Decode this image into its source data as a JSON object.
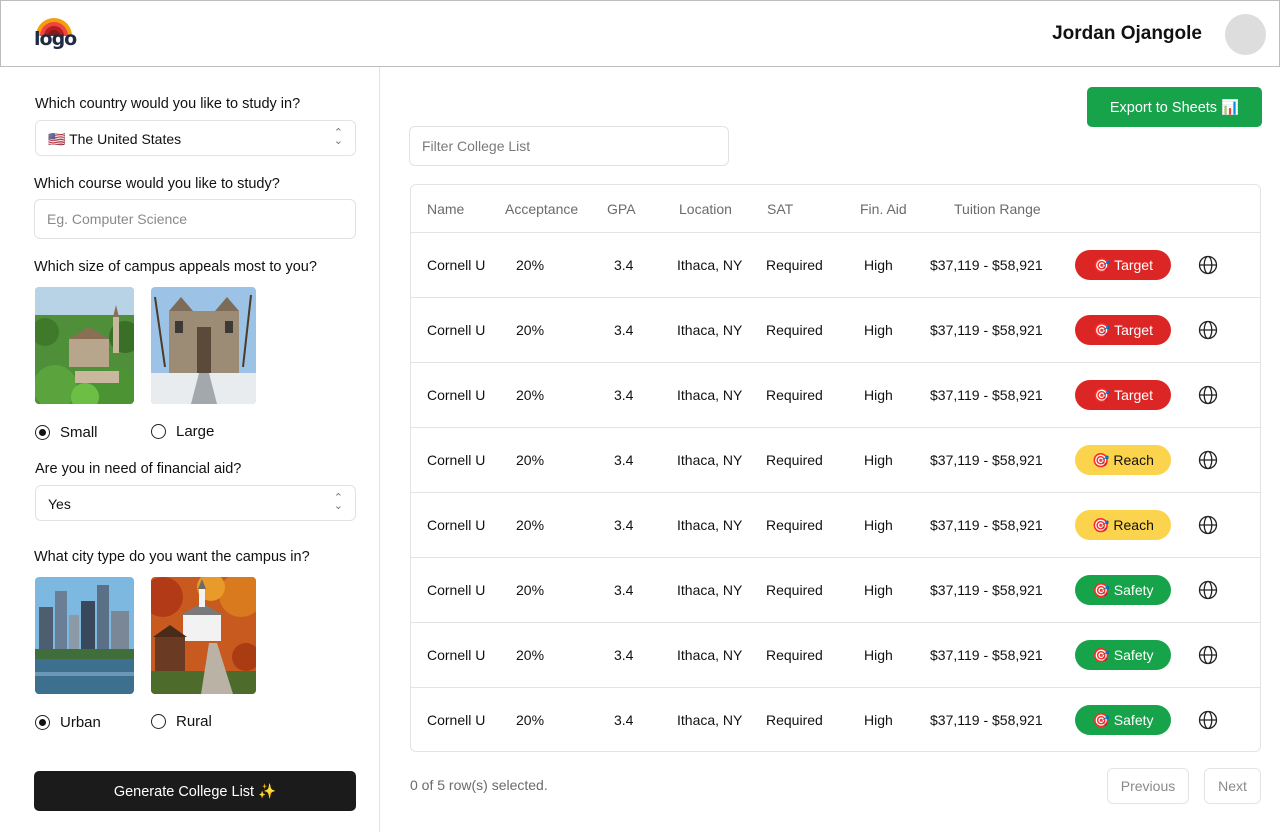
{
  "header": {
    "logo_text": "logo",
    "user_name": "Jordan Ojangole"
  },
  "sidebar": {
    "country_question": "Which country would you like to study in?",
    "country_value": "🇺🇸 The United States",
    "course_question": "Which course would you like to study?",
    "course_placeholder": "Eg. Computer Science",
    "campus_size_question": "Which size of campus appeals most to you?",
    "campus_size_options": [
      "Small",
      "Large"
    ],
    "campus_size_selected": "Small",
    "aid_question": "Are you in need of financial aid?",
    "aid_value": "Yes",
    "city_type_question": "What city type do you want the campus in?",
    "city_type_options": [
      "Urban",
      "Rural"
    ],
    "city_type_selected": "Urban",
    "generate_label": "Generate College List ✨"
  },
  "main": {
    "export_label": "Export to Sheets 📊",
    "filter_placeholder": "Filter College List",
    "columns": [
      "Name",
      "Acceptance",
      "GPA",
      "Location",
      "SAT",
      "Fin. Aid",
      "Tuition Range"
    ],
    "rows": [
      {
        "name": "Cornell U",
        "acceptance": "20%",
        "gpa": "3.4",
        "location": "Ithaca, NY",
        "sat": "Required",
        "aid": "High",
        "tuition": "$37,119 - $58,921",
        "tag": "🎯 Target",
        "tag_type": "target"
      },
      {
        "name": "Cornell U",
        "acceptance": "20%",
        "gpa": "3.4",
        "location": "Ithaca, NY",
        "sat": "Required",
        "aid": "High",
        "tuition": "$37,119 - $58,921",
        "tag": "🎯 Target",
        "tag_type": "target"
      },
      {
        "name": "Cornell U",
        "acceptance": "20%",
        "gpa": "3.4",
        "location": "Ithaca, NY",
        "sat": "Required",
        "aid": "High",
        "tuition": "$37,119 - $58,921",
        "tag": "🎯 Target",
        "tag_type": "target"
      },
      {
        "name": "Cornell U",
        "acceptance": "20%",
        "gpa": "3.4",
        "location": "Ithaca, NY",
        "sat": "Required",
        "aid": "High",
        "tuition": "$37,119 - $58,921",
        "tag": "🎯 Reach",
        "tag_type": "reach"
      },
      {
        "name": "Cornell U",
        "acceptance": "20%",
        "gpa": "3.4",
        "location": "Ithaca, NY",
        "sat": "Required",
        "aid": "High",
        "tuition": "$37,119 - $58,921",
        "tag": "🎯 Reach",
        "tag_type": "reach"
      },
      {
        "name": "Cornell U",
        "acceptance": "20%",
        "gpa": "3.4",
        "location": "Ithaca, NY",
        "sat": "Required",
        "aid": "High",
        "tuition": "$37,119 - $58,921",
        "tag": "🎯 Safety",
        "tag_type": "safety"
      },
      {
        "name": "Cornell U",
        "acceptance": "20%",
        "gpa": "3.4",
        "location": "Ithaca, NY",
        "sat": "Required",
        "aid": "High",
        "tuition": "$37,119 - $58,921",
        "tag": "🎯 Safety",
        "tag_type": "safety"
      },
      {
        "name": "Cornell U",
        "acceptance": "20%",
        "gpa": "3.4",
        "location": "Ithaca, NY",
        "sat": "Required",
        "aid": "High",
        "tuition": "$37,119 - $58,921",
        "tag": "🎯 Safety",
        "tag_type": "safety"
      }
    ],
    "selection_status": "0 of 5 row(s) selected.",
    "previous_label": "Previous",
    "next_label": "Next"
  },
  "colors": {
    "target": "#dc2626",
    "reach": "#fcd34d",
    "safety": "#16a34a",
    "export": "#16a34a",
    "generate": "#1b1b1b"
  },
  "icons": {
    "row_link": "globe-icon",
    "select": "chevron-up-down-icon"
  }
}
